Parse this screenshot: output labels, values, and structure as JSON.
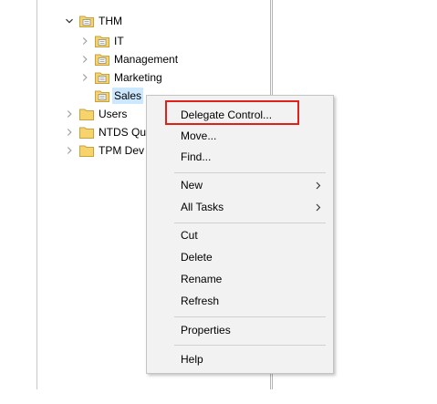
{
  "tree": {
    "nodes": [
      {
        "label": "THM",
        "expander": "chevron-down-icon",
        "icon": "ou-folder-icon"
      },
      {
        "label": "IT",
        "expander": "chevron-right-icon",
        "icon": "ou-folder-icon"
      },
      {
        "label": "Management",
        "expander": "chevron-right-icon",
        "icon": "ou-folder-icon"
      },
      {
        "label": "Marketing",
        "expander": "chevron-right-icon",
        "icon": "ou-folder-icon"
      },
      {
        "label": "Sales",
        "expander": "",
        "icon": "ou-folder-icon",
        "selected": true
      },
      {
        "label": "Users",
        "expander": "chevron-right-icon",
        "icon": "folder-icon"
      },
      {
        "label": "NTDS Qu",
        "expander": "chevron-right-icon",
        "icon": "folder-icon"
      },
      {
        "label": "TPM Dev",
        "expander": "chevron-right-icon",
        "icon": "folder-icon"
      }
    ]
  },
  "context_menu": {
    "items": [
      {
        "label": "Delegate Control...",
        "highlighted": true
      },
      {
        "label": "Move..."
      },
      {
        "label": "Find..."
      },
      {
        "label": "New",
        "submenu": "chevron-right-icon"
      },
      {
        "label": "All Tasks",
        "submenu": "chevron-right-icon"
      },
      {
        "label": "Cut"
      },
      {
        "label": "Delete"
      },
      {
        "label": "Rename"
      },
      {
        "label": "Refresh"
      },
      {
        "label": "Properties"
      },
      {
        "label": "Help"
      }
    ]
  },
  "colors": {
    "highlight_border": "#e0201a",
    "selection_background": "#cce8ff",
    "menu_background": "#f2f2f2",
    "folder_yellow": "#f7d36b"
  }
}
